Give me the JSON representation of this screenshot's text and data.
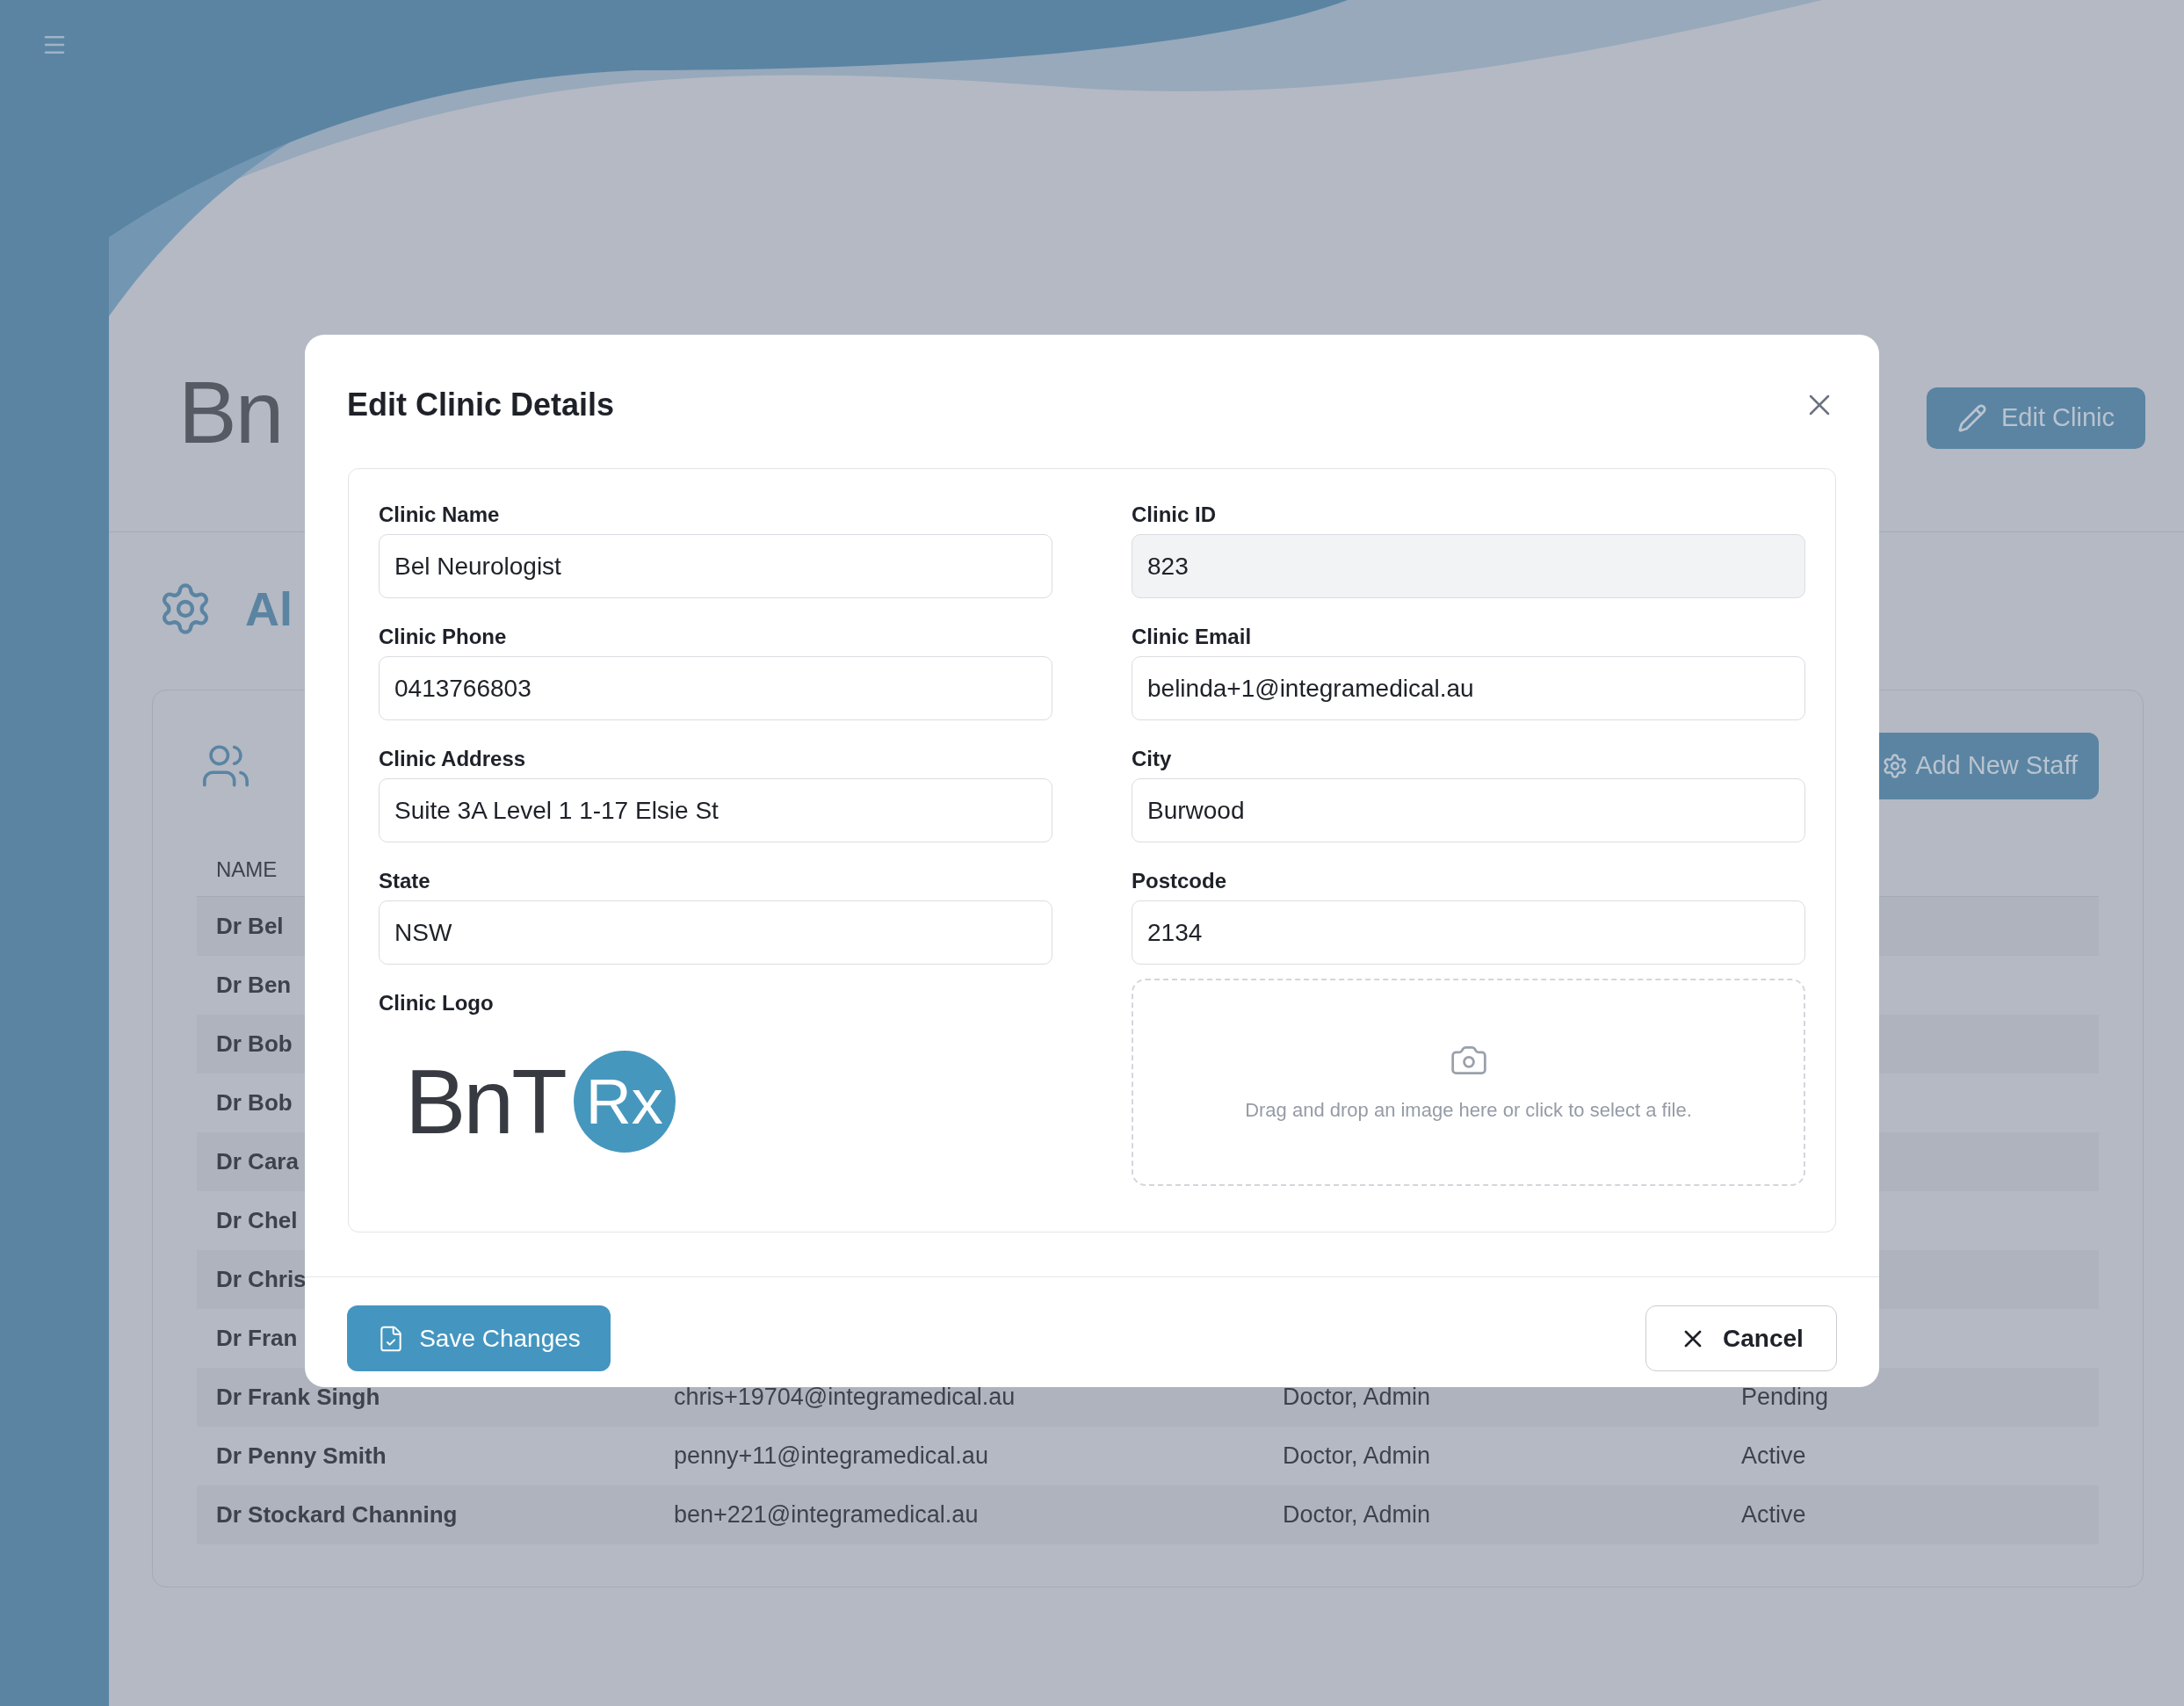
{
  "header": {
    "logo_text": "Bn",
    "edit_button": "Edit Clinic"
  },
  "section": {
    "title": "Al"
  },
  "staff_card": {
    "add_button": "Add New Staff",
    "columns": [
      "NAME"
    ],
    "rows": [
      {
        "name": "Dr Bel"
      },
      {
        "name": "Dr Ben"
      },
      {
        "name": "Dr Bob"
      },
      {
        "name": "Dr Bob"
      },
      {
        "name": "Dr Cara"
      },
      {
        "name": "Dr Chel"
      },
      {
        "name": "Dr Chris"
      },
      {
        "name": "Dr Fran"
      },
      {
        "name": "Dr Frank Singh",
        "email": "chris+19704@integramedical.au",
        "roles": "Doctor, Admin",
        "status": "Pending"
      },
      {
        "name": "Dr Penny Smith",
        "email": "penny+11@integramedical.au",
        "roles": "Doctor, Admin",
        "status": "Active"
      },
      {
        "name": "Dr Stockard Channing",
        "email": "ben+221@integramedical.au",
        "roles": "Doctor, Admin",
        "status": "Active"
      }
    ]
  },
  "dialog": {
    "title": "Edit Clinic Details",
    "fields": [
      {
        "label": "Clinic Name",
        "value": "Bel Neurologist",
        "disabled": false
      },
      {
        "label": "Clinic ID",
        "value": "823",
        "disabled": true
      },
      {
        "label": "Clinic Phone",
        "value": "0413766803",
        "disabled": false
      },
      {
        "label": "Clinic Email",
        "value": "belinda+1@integramedical.au",
        "disabled": false
      },
      {
        "label": "Clinic Address",
        "value": "Suite 3A Level 1 1-17 Elsie St",
        "disabled": false
      },
      {
        "label": "City",
        "value": "Burwood",
        "disabled": false
      },
      {
        "label": "State",
        "value": "NSW",
        "disabled": false
      },
      {
        "label": "Postcode",
        "value": "2134",
        "disabled": false
      }
    ],
    "logo": {
      "label": "Clinic Logo",
      "wordmark": "BnT",
      "badge": "Rx"
    },
    "dropzone": {
      "text": "Drag and drop an image here or click to select a file."
    },
    "save_button": "Save Changes",
    "cancel_button": "Cancel"
  }
}
